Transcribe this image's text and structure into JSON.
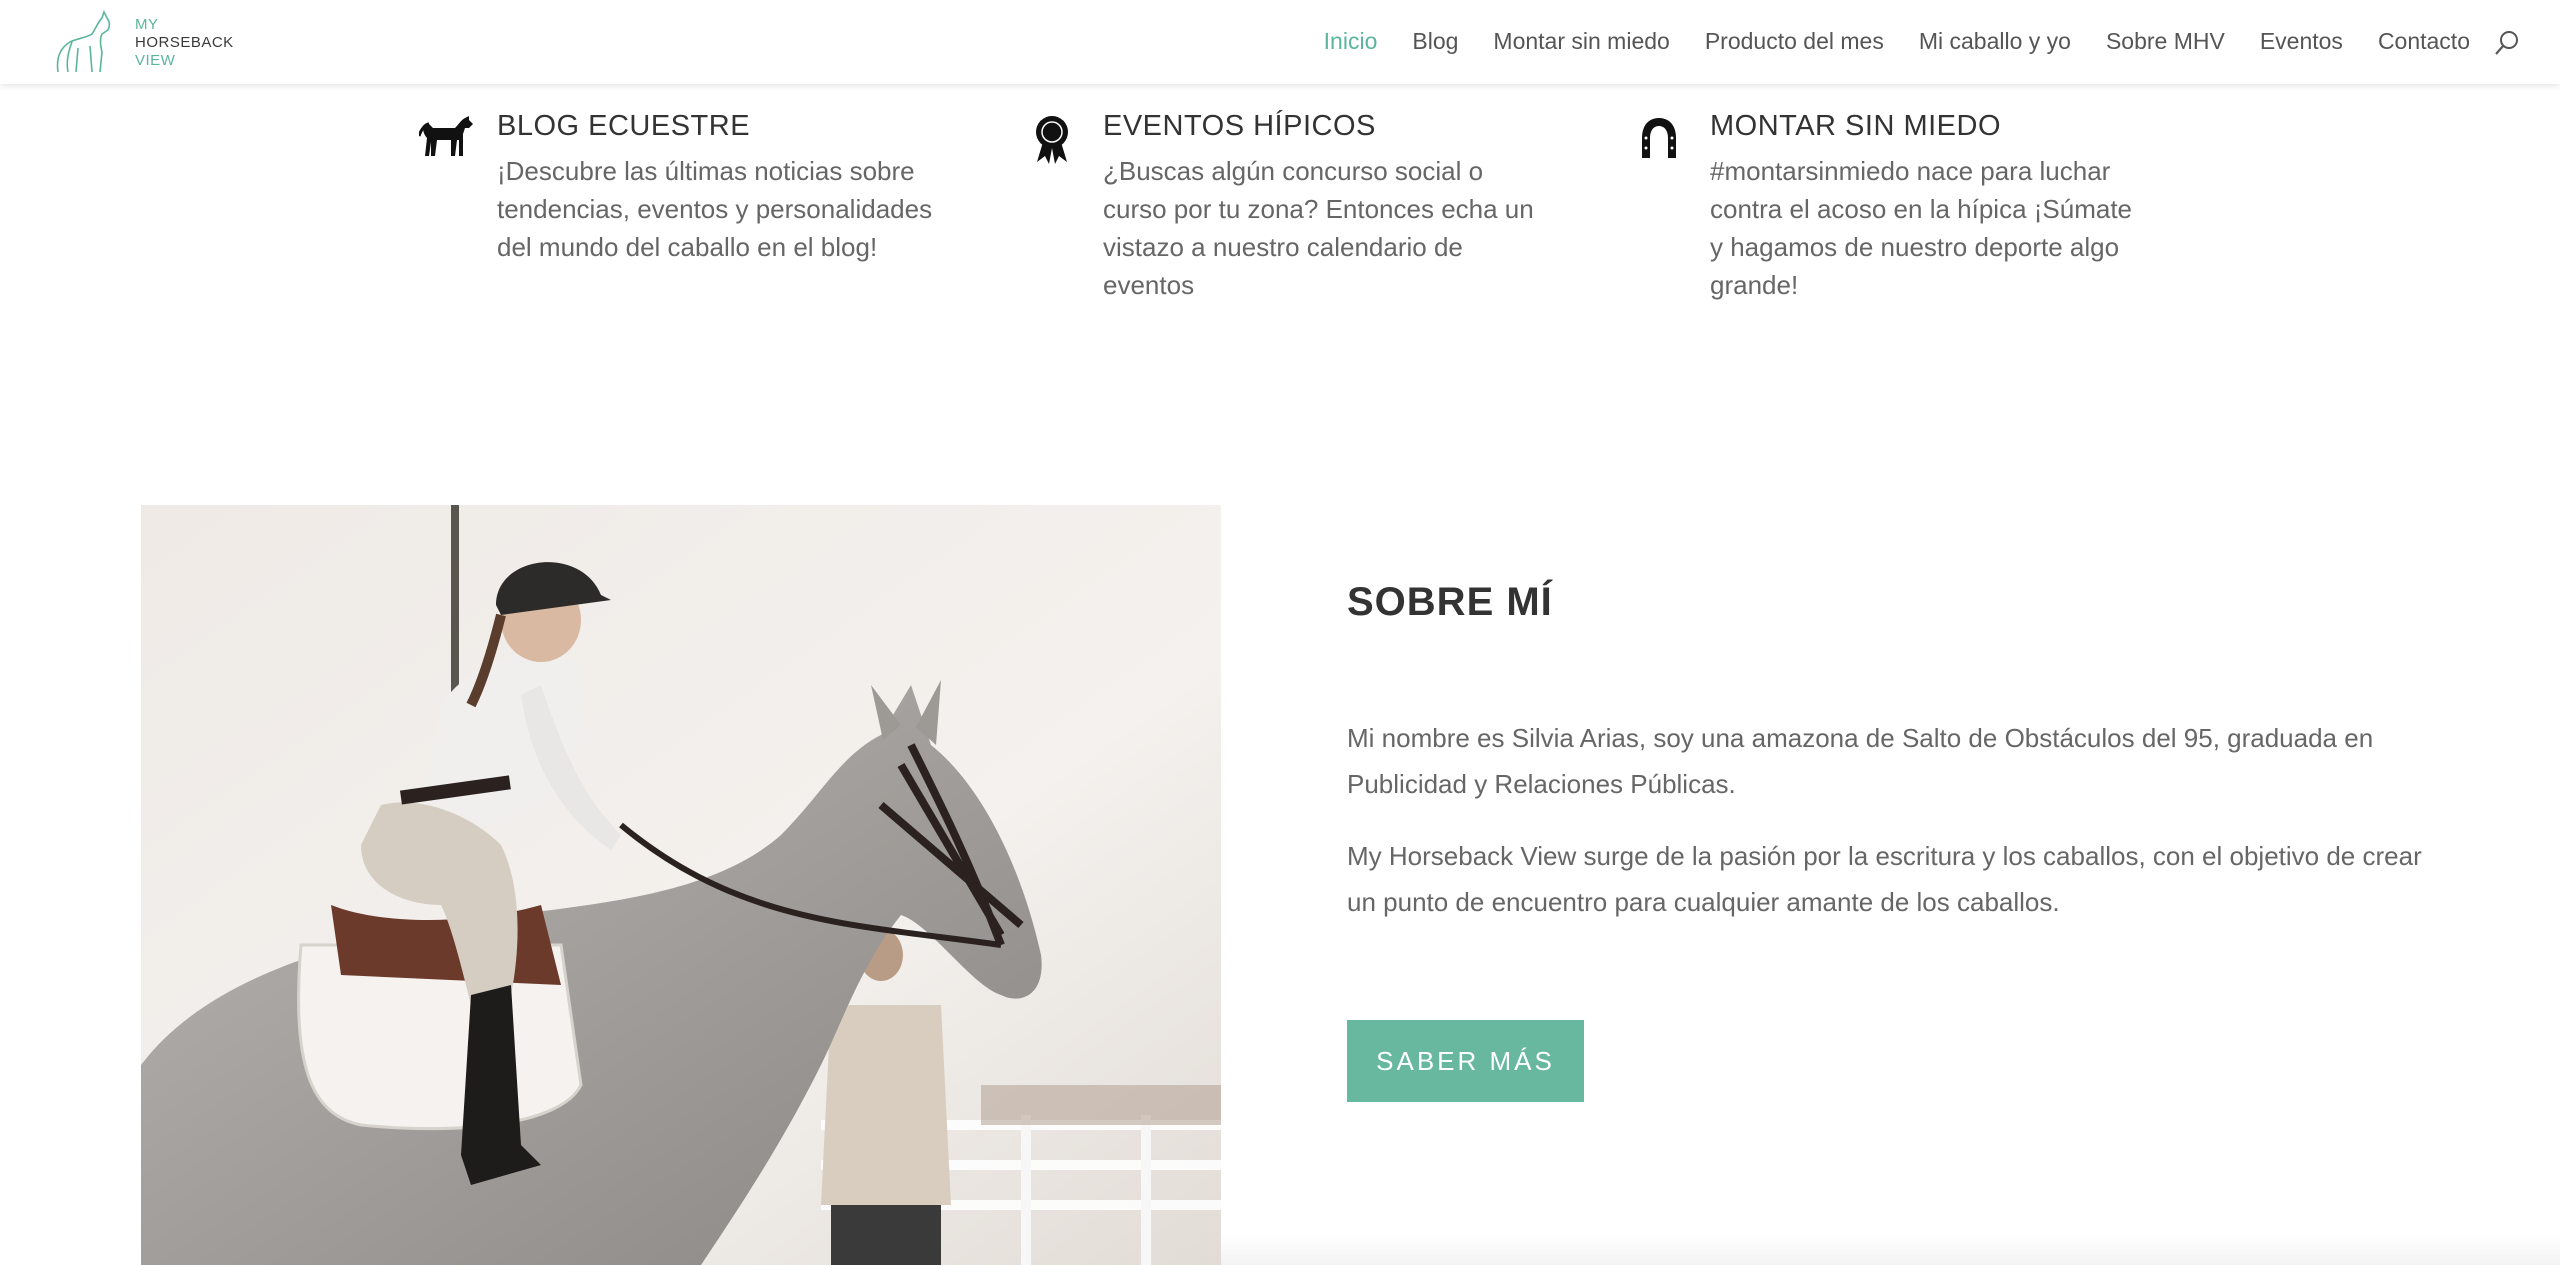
{
  "logo": {
    "line1": "MY",
    "line2": "HORSEBACK",
    "line3": "VIEW"
  },
  "nav": {
    "items": [
      {
        "label": "Inicio",
        "active": true
      },
      {
        "label": "Blog"
      },
      {
        "label": "Montar sin miedo"
      },
      {
        "label": "Producto del mes"
      },
      {
        "label": "Mi caballo y yo"
      },
      {
        "label": "Sobre MHV"
      },
      {
        "label": "Eventos"
      },
      {
        "label": "Contacto"
      }
    ],
    "search_icon": "search-icon"
  },
  "features": [
    {
      "icon": "horse-icon",
      "title": "BLOG ECUESTRE",
      "text": "¡Descubre las últimas noticias sobre tendencias, eventos y personalidades del mundo del caballo en el blog!"
    },
    {
      "icon": "award-ribbon-icon",
      "title": "EVENTOS HÍPICOS",
      "text": "¿Buscas algún concurso social o curso por tu zona? Entonces echa un vistazo a nuestro calendario de eventos"
    },
    {
      "icon": "horseshoe-icon",
      "title": "MONTAR SIN MIEDO",
      "text": "#montarsinmiedo nace para luchar contra el acoso en la hípica ¡Súmate y hagamos de nuestro deporte algo grande!"
    }
  ],
  "about": {
    "title": "SOBRE MÍ",
    "paragraph1": "Mi nombre es Silvia Arias, soy una amazona de Salto de Obstáculos del 95, graduada en Publicidad y Relaciones Públicas.",
    "paragraph2": "My Horseback View surge de la pasión por la escritura y los caballos, con el objetivo de crear un punto de encuentro para cualquier amante de los caballos.",
    "button_label": "SABER MÁS"
  },
  "colors": {
    "accent": "#5bb59c",
    "button": "#67b89f",
    "text": "#666666",
    "heading": "#333333"
  }
}
